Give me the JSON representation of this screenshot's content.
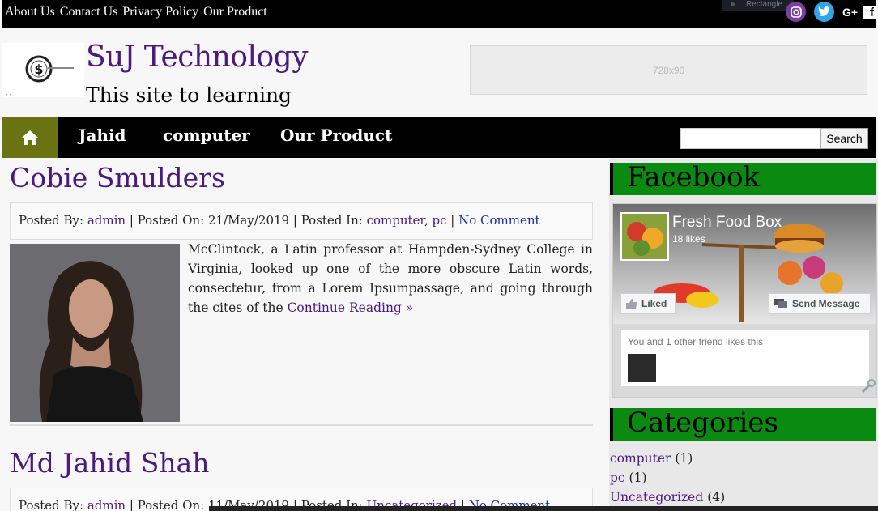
{
  "topbar": {
    "links": [
      "About Us",
      "Contact Us",
      "Privacy Policy",
      "Our Product"
    ],
    "rect_ad_label": "Rectangle",
    "social": [
      "instagram-icon",
      "twitter-icon",
      "google-plus-icon",
      "facebook-icon"
    ],
    "gplus_label": "G+",
    "fb_label": "f"
  },
  "header": {
    "title": "SuJ Technology",
    "tagline": "This site to learning",
    "ad_label": "728x90"
  },
  "nav": {
    "items": [
      "Jahid",
      "computer",
      "Our Product"
    ],
    "search_button": "Search",
    "search_placeholder": ""
  },
  "posts": [
    {
      "title": "Cobie Smulders",
      "meta": {
        "posted_by_label": "Posted By:",
        "author": "admin",
        "posted_on_label": "Posted On:",
        "date": "21/May/2019",
        "posted_in_label": "Posted In:",
        "categories": [
          "computer",
          "pc"
        ],
        "comments": "No Comment"
      },
      "excerpt": "McClintock, a Latin professor at Hampden-Sydney College in Virginia, looked up one of the more obscure Latin words, consectetur, from a Lorem Ipsumpassage, and going through the cites of the",
      "read_more": "Continue Reading »"
    },
    {
      "title": "Md Jahid Shah",
      "meta": {
        "posted_by_label": "Posted By:",
        "author": "admin",
        "posted_on_label": "Posted On:",
        "date": "11/May/2019",
        "posted_in_label": "Posted In:",
        "categories": [
          "Uncategorized"
        ],
        "comments": "No Comment"
      }
    }
  ],
  "sidebar": {
    "facebook": {
      "heading": "Facebook",
      "page_name": "Fresh Food Box",
      "likes": "18 likes",
      "liked_button": "Liked",
      "send_message_button": "Send Message",
      "friends_text": "You and 1 other friend likes this"
    },
    "categories": {
      "heading": "Categories",
      "items": [
        {
          "name": "computer",
          "count": "(1)"
        },
        {
          "name": "pc",
          "count": "(1)"
        },
        {
          "name": "Uncategorized",
          "count": "(4)"
        }
      ]
    }
  },
  "colors": {
    "title_purple": "#4a1a7e",
    "nav_home_olive": "#6b7212",
    "widget_green": "#0a8a10"
  }
}
